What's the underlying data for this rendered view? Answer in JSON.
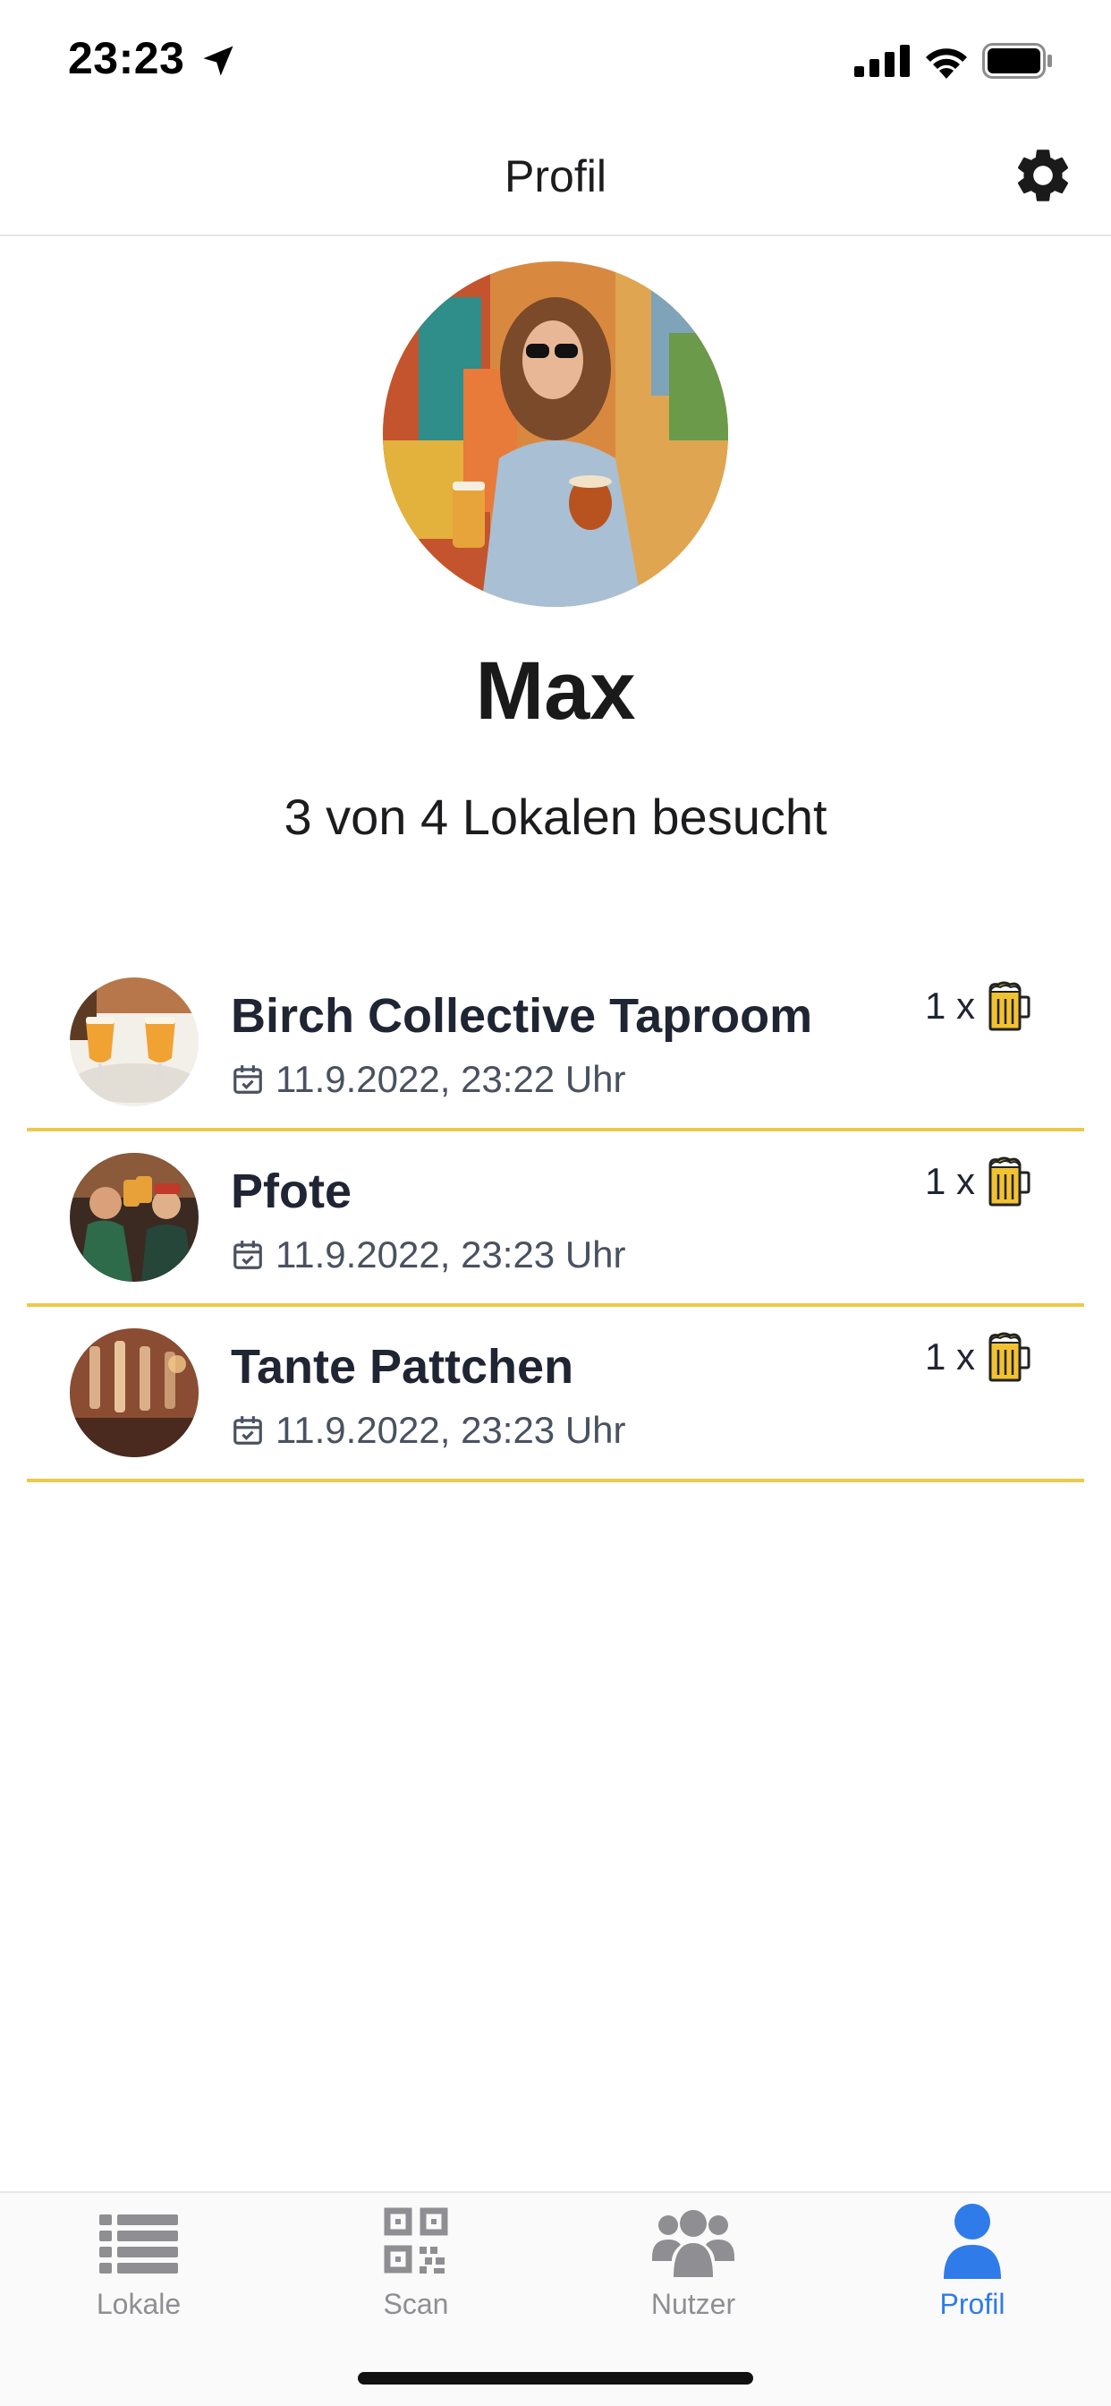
{
  "status_bar": {
    "time": "23:23"
  },
  "header": {
    "title": "Profil"
  },
  "profile": {
    "name": "Max",
    "stats": "3 von 4 Lokalen besucht"
  },
  "visits": [
    {
      "name": "Birch Collective Taproom",
      "date": "11.9.2022, 23:22 Uhr",
      "count": "1 x"
    },
    {
      "name": "Pfote",
      "date": "11.9.2022, 23:23 Uhr",
      "count": "1 x"
    },
    {
      "name": "Tante Pattchen",
      "date": "11.9.2022, 23:23 Uhr",
      "count": "1 x"
    }
  ],
  "tabs": [
    {
      "label": "Lokale",
      "icon": "list-icon",
      "active": false
    },
    {
      "label": "Scan",
      "icon": "qr-code-icon",
      "active": false
    },
    {
      "label": "Nutzer",
      "icon": "users-icon",
      "active": false
    },
    {
      "label": "Profil",
      "icon": "user-icon",
      "active": true
    }
  ],
  "colors": {
    "accent": "#2f7bea",
    "divider": "#ecc94b",
    "inactive_tab": "#8e8e93"
  }
}
